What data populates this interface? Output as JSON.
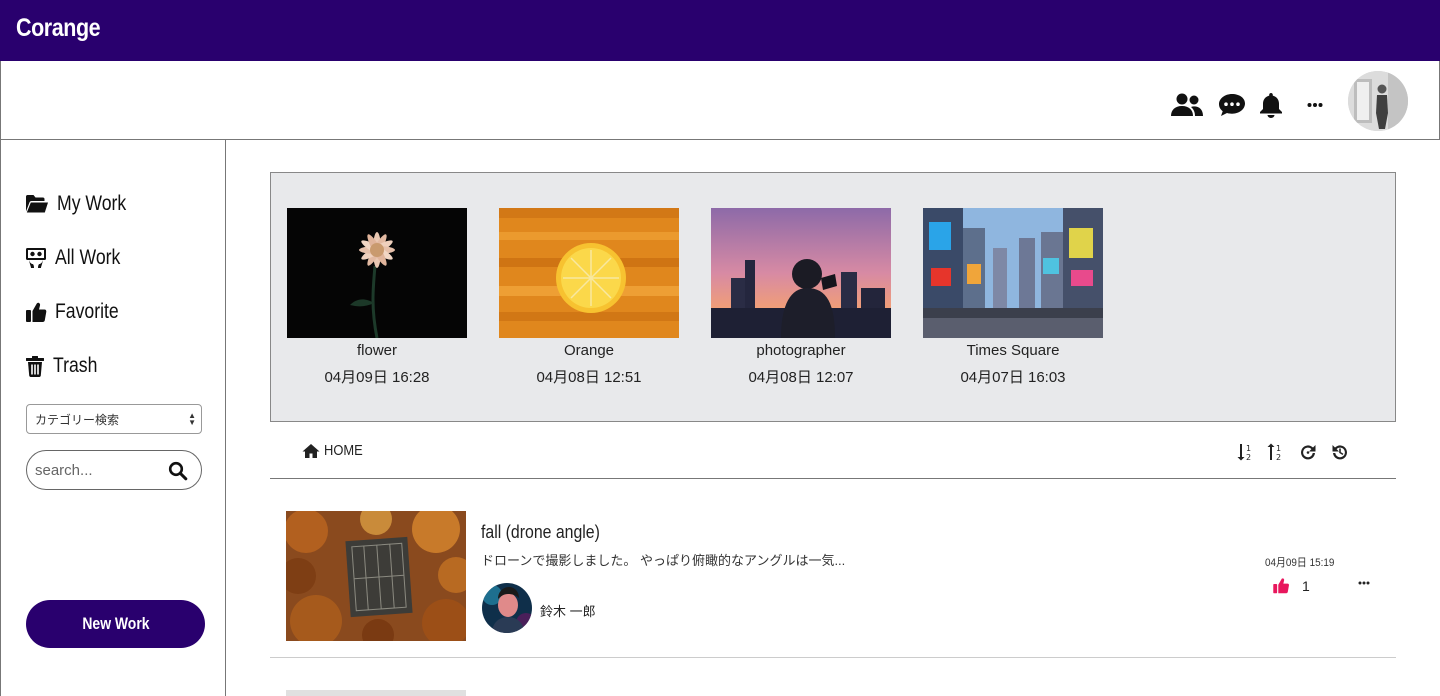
{
  "app": {
    "brand": "Corange"
  },
  "header": {
    "icons": [
      "users-icon",
      "chat-icon",
      "bell-icon",
      "more-icon"
    ],
    "avatar": "user-avatar"
  },
  "sidebar": {
    "items": [
      {
        "label": "My Work",
        "icon": "folder-open-icon"
      },
      {
        "label": "All Work",
        "icon": "slideshare-icon"
      },
      {
        "label": "Favorite",
        "icon": "thumbs-up-icon"
      },
      {
        "label": "Trash",
        "icon": "trash-icon"
      }
    ],
    "category_select": {
      "selected": "カテゴリー検索"
    },
    "search": {
      "placeholder": "search..."
    },
    "new_work_label": "New Work"
  },
  "recent": [
    {
      "title": "flower",
      "date": "04月09日 16:28"
    },
    {
      "title": "Orange",
      "date": "04月08日 12:51"
    },
    {
      "title": "photographer",
      "date": "04月08日 12:07"
    },
    {
      "title": "Times Square",
      "date": "04月07日 16:03"
    }
  ],
  "toolbar": {
    "breadcrumb": "HOME",
    "buttons": [
      "sort-numeric-asc-icon",
      "sort-numeric-desc-icon",
      "redo-icon",
      "history-icon"
    ]
  },
  "posts": [
    {
      "title": "fall (drone angle)",
      "description": "ドローンで撮影しました。 やっぱり俯瞰的なアングルは一気...",
      "author": "鈴木 一郎",
      "date": "04月09日 15:19",
      "likes": "1"
    }
  ],
  "colors": {
    "brand": "#29006e",
    "like": "#e8175d",
    "panel": "#e8e9eb"
  }
}
